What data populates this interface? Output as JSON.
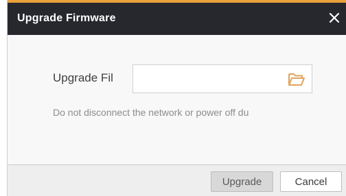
{
  "dialog": {
    "title": "Upgrade Firmware",
    "accent_color": "#e9a13a",
    "titlebar_color": "#26282e"
  },
  "form": {
    "upgrade_file_label": "Upgrade Fil",
    "file_value": "",
    "hint": "Do not disconnect the network or power off du"
  },
  "footer": {
    "upgrade_label": "Upgrade",
    "cancel_label": "Cancel"
  },
  "icons": {
    "close": "close-icon",
    "browse": "folder-open-icon"
  }
}
